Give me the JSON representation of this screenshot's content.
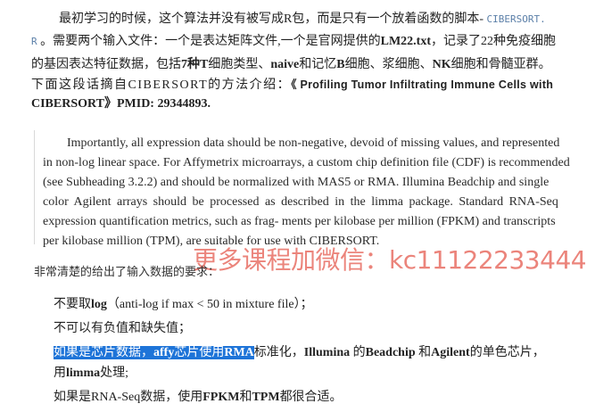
{
  "intro": {
    "line1_text": "最初学习的时候，这个算法并没有被写成R包，而是只有一个放着函数的脚本- ",
    "line1_code": "CIBERSORT.",
    "line2_code": "R",
    "line2_a": " 。需要两个输入文件：一个是表达矩阵文件,一个是官网提供的",
    "line2_bold": "LM22.txt",
    "line2_b": "，记录了22种免疫细胞",
    "line3_a": "的基因表达特征数据，包括",
    "line3_b1": "7种T",
    "line3_c": "细胞类型、",
    "line3_b2": "naive",
    "line3_d": "和记忆",
    "line3_b3": "B",
    "line3_e": "细胞、浆细胞、",
    "line3_b4": "NK",
    "line3_f": "细胞和骨髓亚群。",
    "line4_a": "下面这段话摘自CIBERSORT的方法介绍：",
    "line4_bold": "《 Profiling Tumor Infiltrating Immune Cells with",
    "line5_bold": "CIBERSORT》PMID: 29344893."
  },
  "quote": {
    "lines": [
      "Importantly, all expression data should be non-negative, devoid of missing values, and represented",
      "in non-log linear space. For Affymetrix microarrays, a custom chip definition file (CDF) is recommended",
      "(see Subheading 3.2.2) and should be normalized with MAS5 or RMA. Illumina Beadchip and single",
      "color Agilent arrays should be processed as described in the limma package. Standard RNA-Seq",
      "expression quantification metrics, such as frag- ments per kilobase per million (FPKM) and transcripts",
      "per kilobase million (TPM), are suitable for use with CIBERSORT."
    ]
  },
  "watermark": "更多课程加微信：kc11122233444",
  "requirements_heading": "非常清楚的给出了输入数据的要求：",
  "requirements": {
    "item1_a": "不要取",
    "item1_bold": "log",
    "item1_b": "（anti-log if max < 50 in mixture file）；",
    "item2": "不可以有负值和缺失值；",
    "item3_hl_a": "如果是芯片数据，",
    "item3_hl_bold": "affy",
    "item3_hl_b": "芯片使用",
    "item3_hl_bold2": "RMA",
    "item3_a": "标准化，",
    "item3_bold1": "Illumina",
    "item3_b": " 的",
    "item3_bold2": "Beadchip",
    "item3_c": " 和",
    "item3_bold3": "Agilent",
    "item3_d": "的单色芯片，",
    "item3_cont_a": "用",
    "item3_cont_bold": "limma",
    "item3_cont_b": "处理;",
    "item4_a": "如果是RNA-Seq数据，使用",
    "item4_bold1": "FPKM",
    "item4_b": "和",
    "item4_bold2": "TPM",
    "item4_c": "都很合适。"
  },
  "colors": {
    "highlight": "#1e74d8",
    "watermark": "#e86e64",
    "code": "#5b7fa8"
  }
}
